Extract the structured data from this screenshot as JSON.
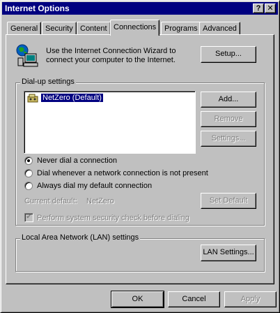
{
  "window": {
    "title": "Internet Options",
    "help_glyph": "?",
    "close_glyph": "✕"
  },
  "tabs": [
    {
      "label": "General"
    },
    {
      "label": "Security"
    },
    {
      "label": "Content"
    },
    {
      "label": "Connections"
    },
    {
      "label": "Programs"
    },
    {
      "label": "Advanced"
    }
  ],
  "wizard": {
    "text_line1": "Use the Internet Connection Wizard to",
    "text_line2": "connect your computer to the Internet.",
    "setup_label": "Setup..."
  },
  "dialup": {
    "group_label": "Dial-up settings",
    "connections": [
      {
        "label": "NetZero (Default)"
      }
    ],
    "add_label": "Add...",
    "remove_label": "Remove",
    "settings_label": "Settings...",
    "options": [
      {
        "label": "Never dial a connection",
        "selected": true
      },
      {
        "label": "Dial whenever a network connection is not present",
        "selected": false
      },
      {
        "label": "Always dial my default connection",
        "selected": false
      }
    ],
    "current_default_label": "Current default:",
    "current_default_value": "NetZero",
    "set_default_label": "Set Default",
    "security_check_label": "Perform system security check before dialing",
    "security_check_glyph": "✔"
  },
  "lan": {
    "group_label": "Local Area Network (LAN) settings",
    "lan_settings_label": "LAN Settings..."
  },
  "footer": {
    "ok_label": "OK",
    "cancel_label": "Cancel",
    "apply_label": "Apply"
  },
  "colors": {
    "titlebar": "#000080",
    "face": "#c0c0c0",
    "selection": "#000080"
  }
}
